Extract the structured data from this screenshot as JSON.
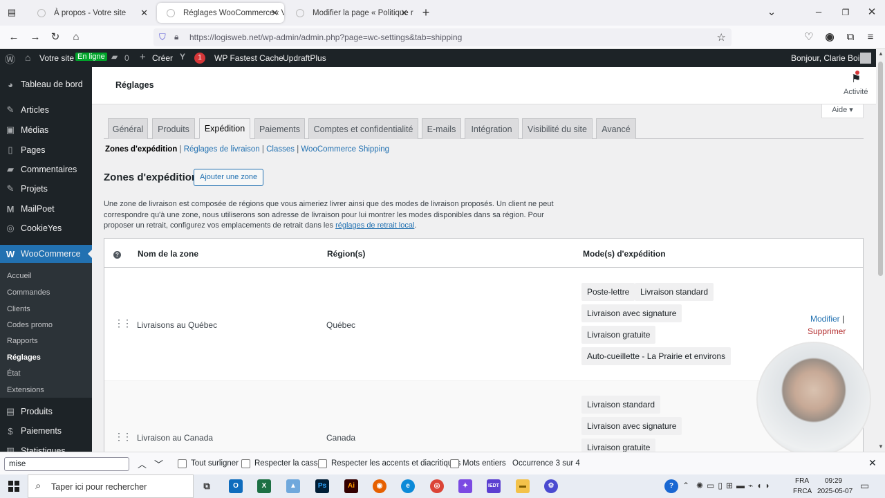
{
  "browser": {
    "tabs": [
      {
        "title": "À propos - Votre site",
        "active": false
      },
      {
        "title": "Réglages WooCommerce ‹ Votre",
        "active": true
      },
      {
        "title": "Modifier la page « Politique rela",
        "active": false
      }
    ],
    "url": "https://logisweb.net/wp-admin/admin.php?page=wc-settings&tab=shipping"
  },
  "adminbar": {
    "site": "Votre site",
    "online": "En ligne",
    "comments": "0",
    "create": "Créer",
    "yoast_count": "1",
    "fastest_cache": "WP Fastest Cache",
    "updraft": "UpdraftPlus",
    "greeting": "Bonjour, Clarie Boily"
  },
  "sidebar": {
    "items": [
      {
        "label": "Tableau de bord",
        "icon": "dashboard-icon"
      },
      {
        "label": "Articles",
        "icon": "pin-icon"
      },
      {
        "label": "Médias",
        "icon": "media-icon"
      },
      {
        "label": "Pages",
        "icon": "page-icon"
      },
      {
        "label": "Commentaires",
        "icon": "comment-icon"
      },
      {
        "label": "Projets",
        "icon": "pin-icon"
      },
      {
        "label": "MailPoet",
        "icon": "mailpoet-icon"
      },
      {
        "label": "CookieYes",
        "icon": "cookie-icon"
      },
      {
        "label": "WooCommerce",
        "icon": "woo-icon"
      }
    ],
    "woo_sub": [
      "Accueil",
      "Commandes",
      "Clients",
      "Codes promo",
      "Rapports",
      "Réglages",
      "État",
      "Extensions"
    ],
    "after": [
      {
        "label": "Produits",
        "icon": "archive-icon"
      },
      {
        "label": "Paiements",
        "icon": "money-icon"
      },
      {
        "label": "Statistiques",
        "icon": "chart-icon"
      }
    ]
  },
  "header": {
    "title": "Réglages",
    "activity": "Activité",
    "help": "Aide ▾"
  },
  "tabs": [
    "Général",
    "Produits",
    "Expédition",
    "Paiements",
    "Comptes et confidentialité",
    "E-mails",
    "Intégration",
    "Visibilité du site",
    "Avancé"
  ],
  "subnav": {
    "current": "Zones d'expédition",
    "links": [
      "Réglages de livraison",
      "Classes",
      "WooCommerce Shipping"
    ],
    "sep": "|"
  },
  "zones": {
    "heading": "Zones d'expédition",
    "add_button": "Ajouter une zone",
    "desc1": "Une zone de livraison est composée de régions que vous aimeriez livrer ainsi que des modes de livraison proposés. Un client ne peut",
    "desc2": "correspondre qu'à une zone, nous utiliserons son adresse de livraison pour lui montrer les modes disponibles dans sa région. Pour",
    "desc3": "proposer un retrait, configurez vos emplacements de retrait dans les",
    "desc_link": "réglages de retrait local",
    "desc_end": ".",
    "columns": {
      "help": "?",
      "name": "Nom de la zone",
      "region": "Région(s)",
      "methods": "Mode(s) d'expédition"
    },
    "rows": [
      {
        "name": "Livraisons au Québec",
        "region": "Québec",
        "methods": [
          "Poste-lettre",
          "Livraison standard",
          "Livraison avec signature",
          "Livraison gratuite",
          "Auto-cueillette - La Prairie et environs"
        ],
        "edit": "Modifier",
        "sep": "|",
        "delete": "Supprimer"
      },
      {
        "name": "Livraison au Canada",
        "region": "Canada",
        "methods": [
          "Livraison standard",
          "Livraison avec signature",
          "Livraison gratuite"
        ]
      }
    ]
  },
  "findbar": {
    "query": "mise",
    "options": [
      "Tout surligner",
      "Respecter la casse",
      "Respecter les accents et diacritiques",
      "Mots entiers"
    ],
    "status": "Occurrence 3 sur 4"
  },
  "taskbar": {
    "search": "Taper ici pour rechercher",
    "lang1": "FRA",
    "lang2": "FRCA",
    "time": "09:29",
    "date": "2025-05-07"
  }
}
